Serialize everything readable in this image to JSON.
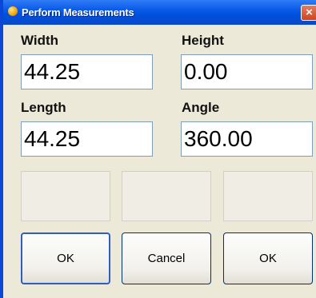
{
  "window": {
    "title": "Perform Measurements",
    "close_glyph": "×",
    "icon": "app-orb-icon"
  },
  "fields": [
    {
      "label": "Width",
      "value": "44.25"
    },
    {
      "label": "Height",
      "value": "0.00"
    },
    {
      "label": "Length",
      "value": "44.25"
    },
    {
      "label": "Angle",
      "value": "360.00"
    }
  ],
  "buttons": {
    "ok_left": "OK",
    "cancel": "Cancel",
    "ok_right": "OK"
  }
}
